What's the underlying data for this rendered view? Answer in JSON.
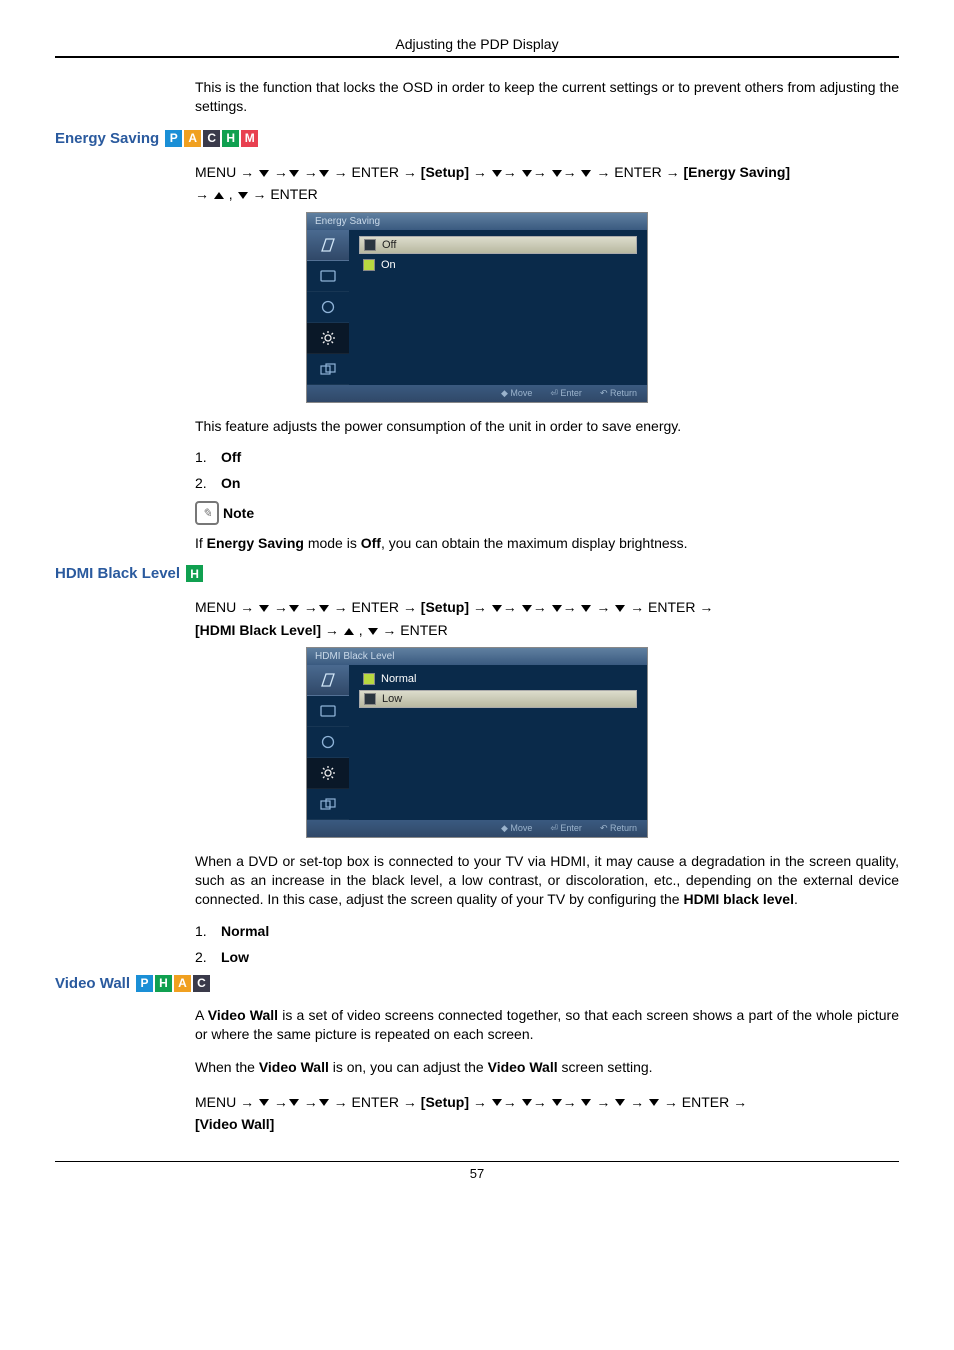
{
  "header": {
    "title": "Adjusting the PDP Display"
  },
  "intro": "This is the function that locks the OSD in order to keep the current settings or to prevent others from adjusting the settings.",
  "energy": {
    "title": "Energy Saving",
    "badges": [
      "P",
      "A",
      "C",
      "H",
      "M"
    ],
    "nav_pre": "MENU → ▼ →▼ →▼ → ENTER → ",
    "nav_setup": "[Setup]",
    "nav_mid": " → ▼→ ▼→ ▼→ ▼ → ENTER → ",
    "nav_target": "[Energy Saving]",
    "nav_post": " → ▲ , ▼ → ENTER",
    "osd_title": "Energy Saving",
    "options": [
      {
        "label": "Off",
        "checked": false,
        "selected": true
      },
      {
        "label": "On",
        "checked": true,
        "selected": false
      }
    ],
    "desc": "This feature adjusts the power consumption of the unit in order to save energy.",
    "list": [
      "Off",
      "On"
    ],
    "note_label": "Note",
    "note_text_a": "If ",
    "note_text_b": "Energy Saving",
    "note_text_c": " mode is ",
    "note_text_d": "Off",
    "note_text_e": ", you can obtain the maximum display brightness."
  },
  "hdmi": {
    "title": "HDMI Black Level",
    "badges": [
      "H"
    ],
    "nav_pre": "MENU → ▼ →▼ →▼ → ENTER → ",
    "nav_setup": "[Setup]",
    "nav_mid": " → ▼→ ▼→ ▼→ ▼ → ▼ → ENTER → ",
    "nav_target": "[HDMI Black Level]",
    "nav_post": " → ▲ , ▼ → ENTER",
    "osd_title": "HDMI Black Level",
    "options": [
      {
        "label": "Normal",
        "checked": true,
        "selected": false
      },
      {
        "label": "Low",
        "checked": false,
        "selected": true
      }
    ],
    "desc_a": "When a DVD or set-top box is connected to your TV via HDMI, it may cause a degradation in the screen quality, such as an increase in the black level, a low contrast, or discoloration, etc., depending on the external device connected. In this case, adjust the screen quality of your TV by configuring the ",
    "desc_b": "HDMI black level",
    "desc_c": ".",
    "list": [
      "Normal",
      "Low"
    ]
  },
  "videowall": {
    "title": "Video Wall",
    "badges": [
      "P",
      "H",
      "A",
      "C"
    ],
    "p1_a": "A ",
    "p1_b": "Video Wall",
    "p1_c": " is a set of video screens connected together, so that each screen shows a part of the whole picture or where the same picture is repeated on each screen.",
    "p2_a": "When the ",
    "p2_b": "Video Wall",
    "p2_c": " is on, you can adjust the ",
    "p2_d": "Video Wall",
    "p2_e": " screen setting.",
    "nav_pre": "MENU → ▼ →▼ →▼ → ENTER → ",
    "nav_setup": "[Setup]",
    "nav_mid": " → ▼→ ▼→ ▼→ ▼ → ▼ → ▼ → ENTER → ",
    "nav_target": "[Video Wall]"
  },
  "osd_footer": {
    "move": "Move",
    "enter": "Enter",
    "return": "Return"
  },
  "footer": {
    "page": "57"
  }
}
